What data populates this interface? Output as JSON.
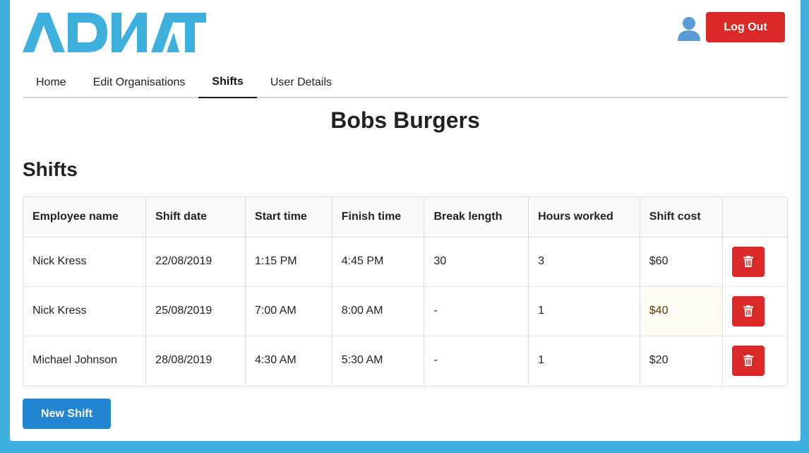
{
  "brand": {
    "logo_text": "TANDA",
    "color": "#3eb0de"
  },
  "header": {
    "user_icon": "user-icon",
    "logout_label": "Log Out"
  },
  "nav": {
    "items": [
      {
        "label": "Home",
        "active": false
      },
      {
        "label": "Edit Organisations",
        "active": false
      },
      {
        "label": "Shifts",
        "active": true
      },
      {
        "label": "User Details",
        "active": false
      }
    ]
  },
  "organisation": {
    "name": "Bobs Burgers"
  },
  "shifts_section": {
    "title": "Shifts",
    "columns": [
      "Employee name",
      "Shift date",
      "Start time",
      "Finish time",
      "Break length",
      "Hours worked",
      "Shift cost",
      ""
    ],
    "rows": [
      {
        "employee": "Nick Kress",
        "date": "22/08/2019",
        "start": "1:15 PM",
        "finish": "4:45 PM",
        "break": "30",
        "hours": "3",
        "cost": "$60",
        "highlight": false
      },
      {
        "employee": "Nick Kress",
        "date": "25/08/2019",
        "start": "7:00 AM",
        "finish": "8:00 AM",
        "break": "-",
        "hours": "1",
        "cost": "$40",
        "highlight": true
      },
      {
        "employee": "Michael Johnson",
        "date": "28/08/2019",
        "start": "4:30 AM",
        "finish": "5:30 AM",
        "break": "-",
        "hours": "1",
        "cost": "$20",
        "highlight": false
      }
    ],
    "delete_icon": "trash-icon",
    "new_shift_label": "New Shift"
  },
  "colors": {
    "danger": "#db2828",
    "primary": "#2185d0",
    "warning_bg": "#fffaf3"
  }
}
